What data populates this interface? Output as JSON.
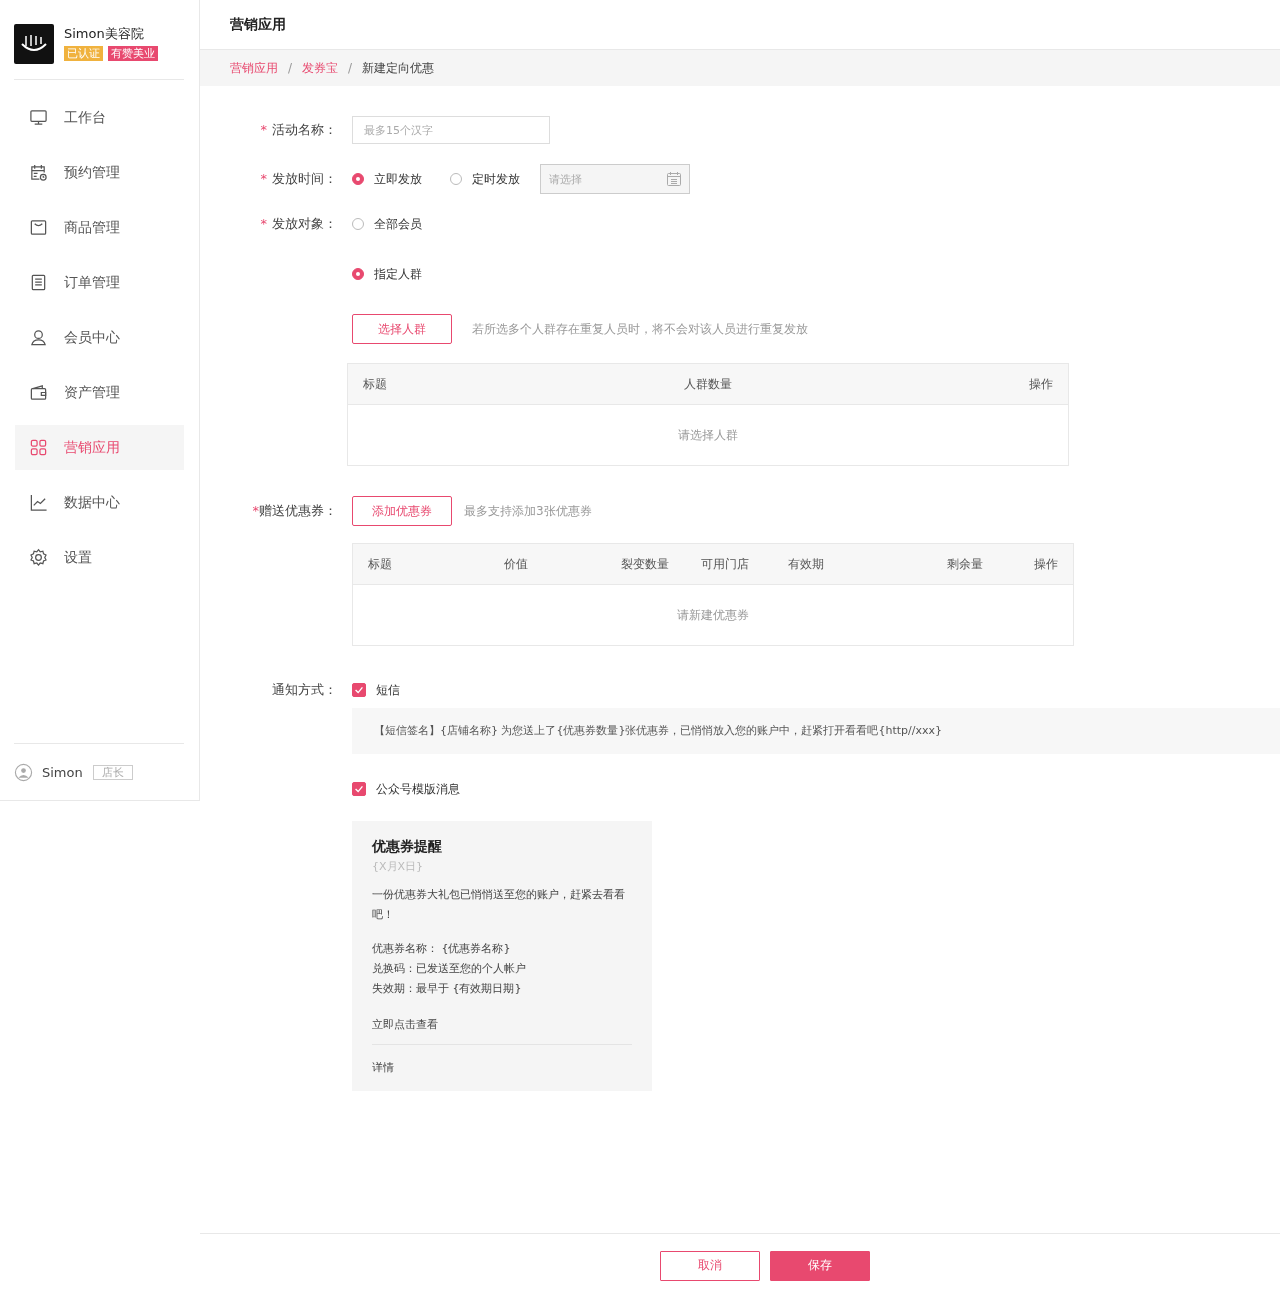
{
  "sidebar": {
    "shop_name": "Simon美容院",
    "badges": [
      {
        "label": "已认证",
        "color": "#f0b23e"
      },
      {
        "label": "有赞美业",
        "color": "#e8496f"
      }
    ],
    "items": [
      {
        "label": "工作台",
        "selected": false
      },
      {
        "label": "预约管理",
        "selected": false
      },
      {
        "label": "商品管理",
        "selected": false
      },
      {
        "label": "订单管理",
        "selected": false
      },
      {
        "label": "会员中心",
        "selected": false
      },
      {
        "label": "资产管理",
        "selected": false
      },
      {
        "label": "营销应用",
        "selected": true
      },
      {
        "label": "数据中心",
        "selected": false
      },
      {
        "label": "设置",
        "selected": false
      }
    ],
    "user": {
      "name": "Simon",
      "role": "店长"
    }
  },
  "header": {
    "title": "营销应用"
  },
  "breadcrumb": [
    {
      "label": "营销应用",
      "current": false
    },
    {
      "separator": "/",
      "label": "发券宝",
      "current": false
    },
    {
      "separator": "/",
      "label": "新建定向优惠",
      "current": true
    }
  ],
  "form": {
    "name": {
      "label": "活动名称：",
      "required_mark": "*",
      "placeholder": "最多15个汉字"
    },
    "time": {
      "label": "发放时间：",
      "required_mark": "*",
      "options": [
        {
          "label": "立即发放",
          "selected": true
        },
        {
          "label": "定时发放",
          "selected": false
        }
      ],
      "date_placeholder": "请选择"
    },
    "target": {
      "label": "发放对象：",
      "required_mark": "*",
      "options": [
        {
          "label": "全部会员",
          "selected": false
        },
        {
          "label": "指定人群",
          "selected": true
        }
      ],
      "button": "选择人群",
      "hint": "若所选多个人群存在重复人员时，将不会对该人员进行重复发放",
      "table": {
        "columns": [
          "标题",
          "人群数量",
          "操作"
        ],
        "empty": "请选择人群"
      }
    },
    "coupons": {
      "label": "赠送优惠券：",
      "required_mark": "*",
      "button": "添加优惠券",
      "hint": "最多支持添加3张优惠券",
      "table": {
        "columns": [
          "标题",
          "价值",
          "裂变数量",
          "可用门店",
          "有效期",
          "剩余量",
          "操作"
        ],
        "empty": "请新建优惠券"
      }
    },
    "notify": {
      "label": "通知方式：",
      "channels": [
        {
          "kind": "sms",
          "label": "短信",
          "checked": true,
          "message": "【短信签名】{店铺名称} 为您送上了{优惠券数量}张优惠券，已悄悄放入您的账户中，赶紧打开看看吧{http//xxx}"
        },
        {
          "kind": "template",
          "label": "公众号模版消息",
          "checked": true,
          "card": {
            "title": "优惠券提醒",
            "date": "{X月X日}",
            "intro": "一份优惠券大礼包已悄悄送至您的账户，赶紧去看看吧！",
            "fields": [
              "优惠券名称：  {优惠券名称}",
              "兑换码：已发送至您的个人帐户",
              "失效期：最早于 {有效期日期}"
            ],
            "action": "立即点击查看",
            "details": "详情"
          }
        }
      ]
    }
  },
  "footer": {
    "buttons": [
      {
        "kind": "secondary",
        "label": "取消"
      },
      {
        "kind": "primary",
        "label": "保存"
      }
    ]
  }
}
